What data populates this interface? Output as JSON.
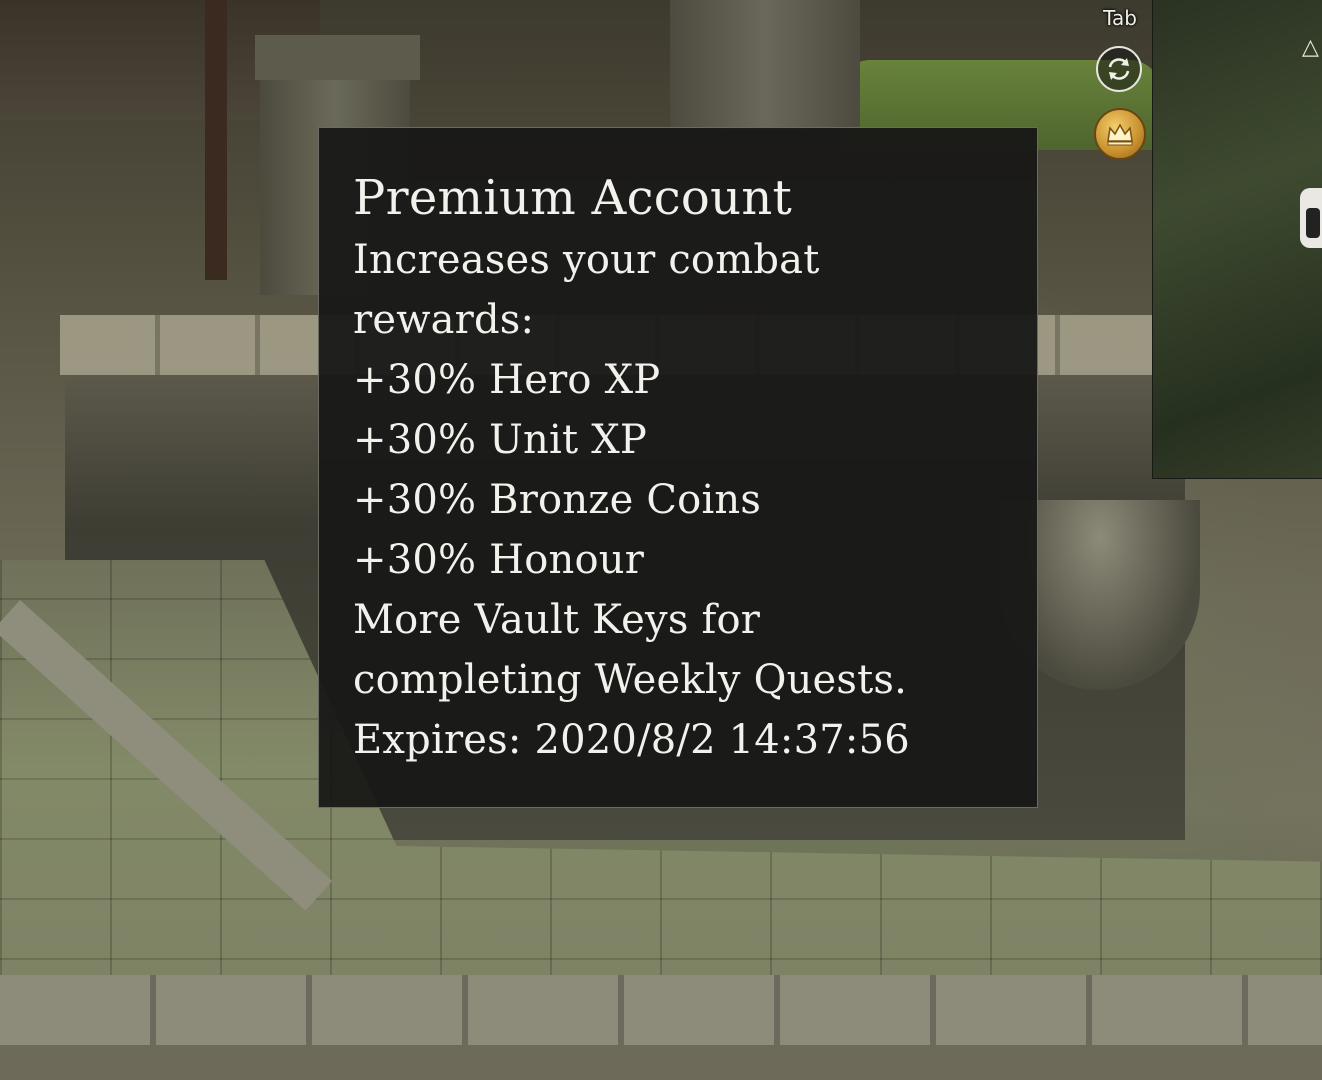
{
  "hud": {
    "tab_hint": "Tab",
    "swap_icon": "swap-arrows-icon",
    "premium_icon": "crown-icon",
    "accent_gold": "#d9a640"
  },
  "tooltip": {
    "title": "Premium Account",
    "lines": [
      "Increases your combat",
      "rewards:",
      "+30% Hero XP",
      "+30% Unit XP",
      "+30% Bronze Coins",
      "+30% Honour",
      "More Vault Keys for",
      "completing Weekly Quests.",
      "Expires: 2020/8/2 14:37:56"
    ],
    "background_color": "#181817",
    "border_color": "#6b6b66",
    "text_color": "#f2f1ec"
  }
}
